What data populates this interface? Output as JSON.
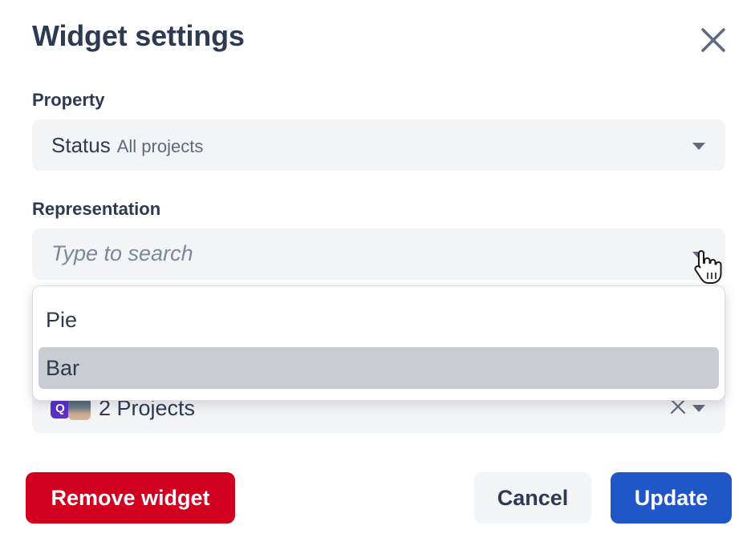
{
  "dialog": {
    "title": "Widget settings",
    "close_icon": "close-icon"
  },
  "property": {
    "label": "Property",
    "value": "Status",
    "scope": "All projects"
  },
  "representation": {
    "label": "Representation",
    "placeholder": "Type to search",
    "value": "",
    "options": [
      {
        "label": "Pie",
        "highlighted": false
      },
      {
        "label": "Bar",
        "highlighted": true
      }
    ]
  },
  "projects": {
    "value": "2 Projects",
    "icon_letter": "Q"
  },
  "buttons": {
    "remove": "Remove widget",
    "cancel": "Cancel",
    "update": "Update"
  },
  "colors": {
    "danger": "#d1001f",
    "primary": "#1f57c9",
    "field_bg": "#f3f4f6",
    "highlight": "#c9ccd1"
  }
}
